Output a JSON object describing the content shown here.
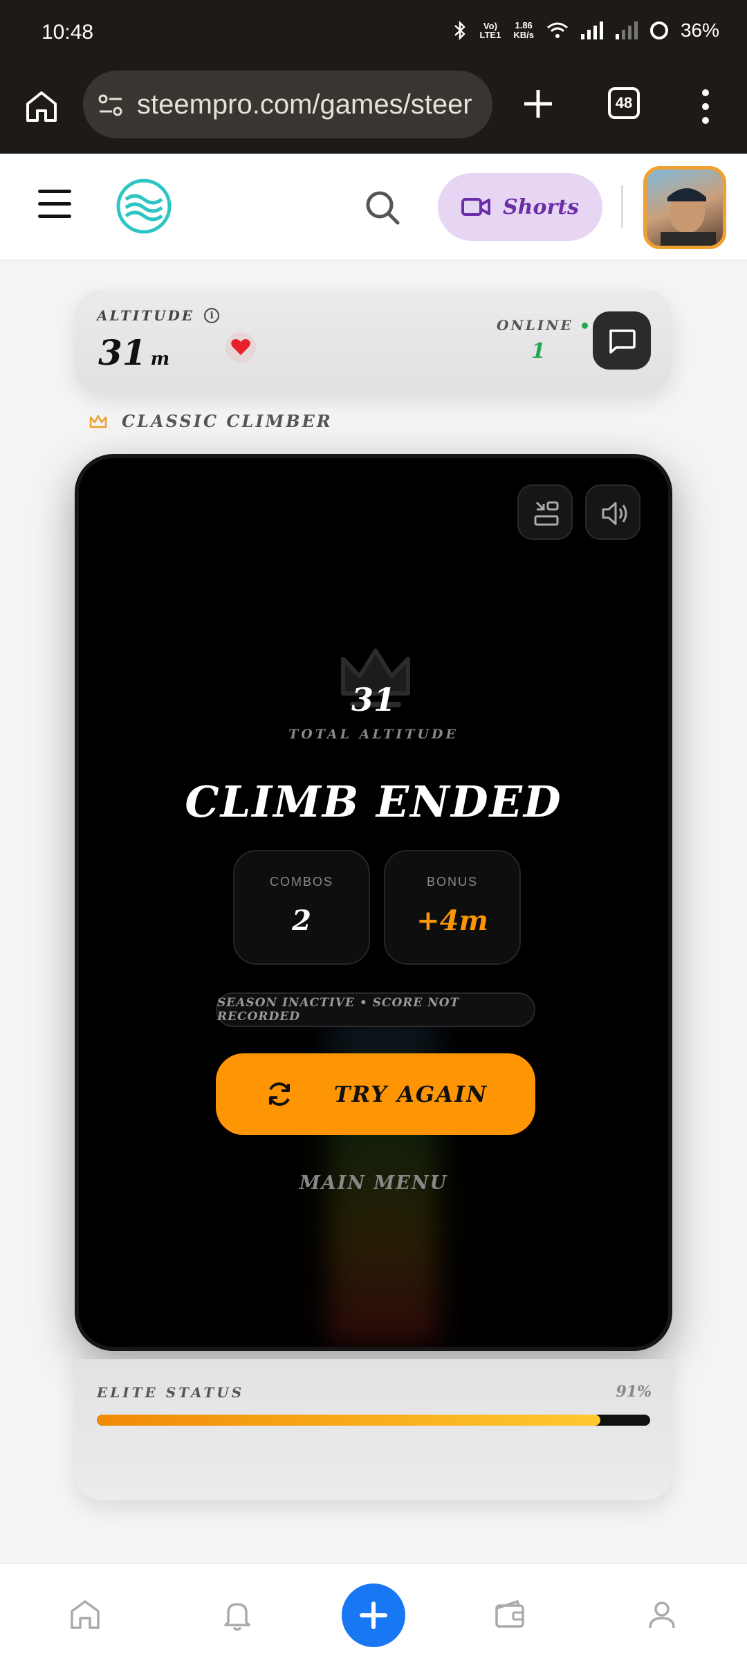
{
  "status_bar": {
    "time": "10:48",
    "network": "LTE1",
    "net_speed_value": "1.86",
    "net_speed_unit": "KB/s",
    "battery": "36%"
  },
  "browser": {
    "url": "steempro.com/games/steer",
    "tab_count": "48"
  },
  "header": {
    "shorts_label": "Shorts"
  },
  "altitude_panel": {
    "label": "ALTITUDE",
    "value": "31",
    "unit": "m",
    "online_label": "ONLINE",
    "online_count": "1"
  },
  "mode": {
    "label": "CLASSIC CLIMBER"
  },
  "game": {
    "total_value": "31",
    "total_label": "TOTAL ALTITUDE",
    "title": "CLIMB ENDED",
    "combos_label": "COMBOS",
    "combos_value": "2",
    "bonus_label": "BONUS",
    "bonus_value": "+4m",
    "season_notice": "SEASON INACTIVE • SCORE NOT RECORDED",
    "try_again_label": "TRY AGAIN",
    "main_menu_label": "MAIN MENU"
  },
  "elite_status": {
    "label": "ELITE STATUS",
    "percent_text": "91%",
    "progress": 0.91
  },
  "colors": {
    "accent_orange": "#fd9505",
    "online_green": "#22a94f",
    "shorts_purple": "#6b2ea6",
    "fab_blue": "#1877f2"
  },
  "icons": [
    "home-icon",
    "tune-icon",
    "plus-icon",
    "more-icon",
    "menu-icon",
    "steem-logo",
    "search-icon",
    "video-icon",
    "info-icon",
    "heart-icon",
    "chat-icon",
    "crown-icon",
    "layout-icon",
    "sound-icon",
    "refresh-icon",
    "bell-icon",
    "wallet-icon",
    "user-icon"
  ]
}
